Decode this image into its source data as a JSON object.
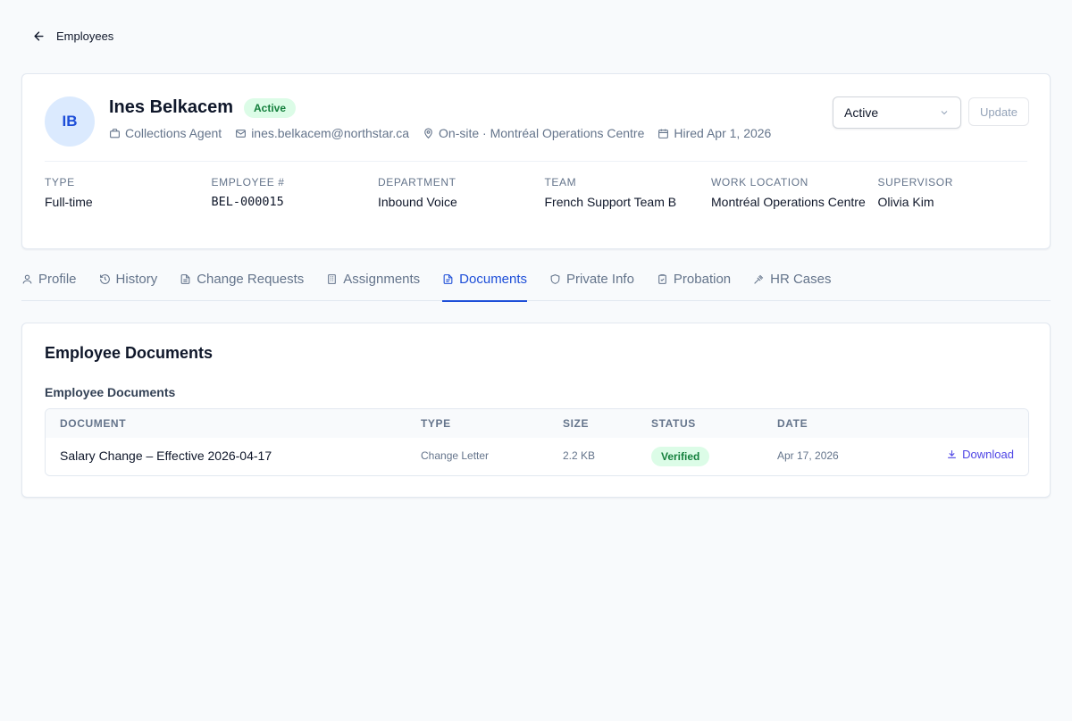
{
  "nav": {
    "back_label": "Employees"
  },
  "employee": {
    "initials": "IB",
    "name": "Ines Belkacem",
    "status_badge": "Active",
    "title": "Collections Agent",
    "email": "ines.belkacem@northstar.ca",
    "location": "On-site · Montréal Operations Centre",
    "hired": "Hired Apr 1, 2026"
  },
  "actions": {
    "status_value": "Active",
    "update_label": "Update"
  },
  "facts": [
    {
      "label": "Type",
      "value": "Full-time"
    },
    {
      "label": "Employee #",
      "value": "BEL-000015"
    },
    {
      "label": "Department",
      "value": "Inbound Voice"
    },
    {
      "label": "Team",
      "value": "French Support Team B"
    },
    {
      "label": "Work Location",
      "value": "Montréal Operations Centre"
    },
    {
      "label": "Supervisor",
      "value": "Olivia Kim"
    }
  ],
  "tabs": [
    {
      "label": "Profile",
      "icon": "user-icon"
    },
    {
      "label": "History",
      "icon": "history-icon"
    },
    {
      "label": "Change Requests",
      "icon": "file-icon"
    },
    {
      "label": "Assignments",
      "icon": "building-icon"
    },
    {
      "label": "Documents",
      "icon": "document-icon",
      "active": true
    },
    {
      "label": "Private Info",
      "icon": "shield-icon"
    },
    {
      "label": "Probation",
      "icon": "clipboard-icon"
    },
    {
      "label": "HR Cases",
      "icon": "gavel-icon"
    }
  ],
  "documents": {
    "card_title": "Employee Documents",
    "section_title": "Employee Documents",
    "columns": [
      "Document",
      "Type",
      "Size",
      "Status",
      "Date"
    ],
    "rows": [
      {
        "document": "Salary Change – Effective 2026-04-17",
        "type": "Change Letter",
        "size": "2.2 KB",
        "status": "Verified",
        "date": "Apr 17, 2026",
        "action": "Download"
      }
    ]
  }
}
